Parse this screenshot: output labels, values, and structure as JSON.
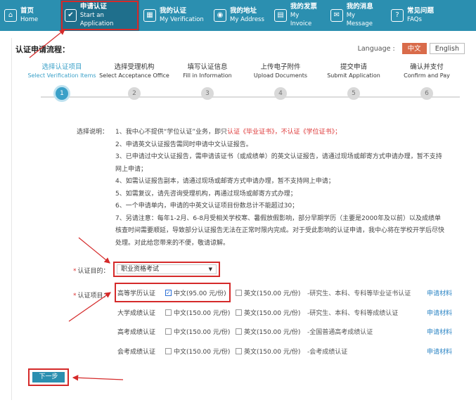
{
  "nav": [
    {
      "cn": "首页",
      "en": "Home",
      "icon": "⌂"
    },
    {
      "cn": "申请认证",
      "en": "Start an Application",
      "icon": "✔"
    },
    {
      "cn": "我的认证",
      "en": "My Verification",
      "icon": "▦"
    },
    {
      "cn": "我的地址",
      "en": "My Address",
      "icon": "◉"
    },
    {
      "cn": "我的发票",
      "en": "My Invoice",
      "icon": "▤"
    },
    {
      "cn": "我的消息",
      "en": "My Message",
      "icon": "✉"
    },
    {
      "cn": "常见问题",
      "en": "FAQs",
      "icon": "?"
    }
  ],
  "process_title": "认证申请流程：",
  "language": {
    "label": "Language :",
    "options": [
      "中文",
      "English"
    ],
    "selected": "中文"
  },
  "steps": [
    {
      "cn": "选择认证项目",
      "en": "Select Verification Items",
      "num": "1"
    },
    {
      "cn": "选择受理机构",
      "en": "Select Acceptance Office",
      "num": "2"
    },
    {
      "cn": "填写认证信息",
      "en": "Fill in Information",
      "num": "3"
    },
    {
      "cn": "上传电子附件",
      "en": "Upload Documents",
      "num": "4"
    },
    {
      "cn": "提交申请",
      "en": "Submit Application",
      "num": "5"
    },
    {
      "cn": "确认并支付",
      "en": "Confirm and Pay",
      "num": "6"
    }
  ],
  "description": {
    "label": "选择说明：",
    "lines": [
      {
        "pre": "1、我中心不提供“学位认证”业务，即只",
        "red": "认证《毕业证书》，不认证《学位证书》",
        "post": "；"
      },
      {
        "pre": "2、申请英文认证报告需同时申请中文认证报告。",
        "red": "",
        "post": ""
      },
      {
        "pre": "3、已申请过中文认证报告，需申请该证书（或成绩单）的英文认证报告，请通过现场或邮寄方式申请办理，暂不支持网上申请；",
        "red": "",
        "post": ""
      },
      {
        "pre": "4、如需认证报告副本，请通过现场或邮寄方式申请办理，暂不支持网上申请；",
        "red": "",
        "post": ""
      },
      {
        "pre": "5、如需复议，请先咨询受理机构，再通过现场或邮寄方式办理；",
        "red": "",
        "post": ""
      },
      {
        "pre": "6、一个申请单内，申请的中英文认证项目份数总计不能超过30；",
        "red": "",
        "post": ""
      },
      {
        "pre": "7、另请注意：每年1-2月、6-8月受相关学校寒、暑假放假影响，部分早期学历（主要是2000年及以前）以及成绩单核查时间需要顺延，导致部分认证报告无法在正常时限内完成。对于受此影响的认证申请，我中心将在学校开学后尽快处理。对此给您带来的不便，敬请谅解。",
        "red": "",
        "post": ""
      }
    ]
  },
  "purpose": {
    "label": "认证目的：",
    "value": "职业资格考试"
  },
  "items_label": "认证项目：",
  "items": [
    {
      "category": "高等学历认证",
      "cn": "中文(95.00 元/份)",
      "cn_checked": true,
      "en": "英文(150.00 元/份)",
      "en_checked": false,
      "note": "-研究生、本科、专科等毕业证书认证",
      "link": "申请材料"
    },
    {
      "category": "大学成绩认证",
      "cn": "中文(150.00 元/份)",
      "cn_checked": false,
      "en": "英文(150.00 元/份)",
      "en_checked": false,
      "note": "-研究生、本科、专科等成绩认证",
      "link": "申请材料"
    },
    {
      "category": "高考成绩认证",
      "cn": "中文(150.00 元/份)",
      "cn_checked": false,
      "en": "英文(150.00 元/份)",
      "en_checked": false,
      "note": "-全国普通高考成绩认证",
      "link": "申请材料"
    },
    {
      "category": "会考成绩认证",
      "cn": "中文(150.00 元/份)",
      "cn_checked": false,
      "en": "英文(150.00 元/份)",
      "en_checked": false,
      "note": "-会考成绩认证",
      "link": "申请材料"
    }
  ],
  "next_button": "下一步",
  "colors": {
    "nav": "#2b8fb0",
    "active_step": "#3aa0c8",
    "highlight": "#d52a2a",
    "link": "#2b84c4"
  }
}
